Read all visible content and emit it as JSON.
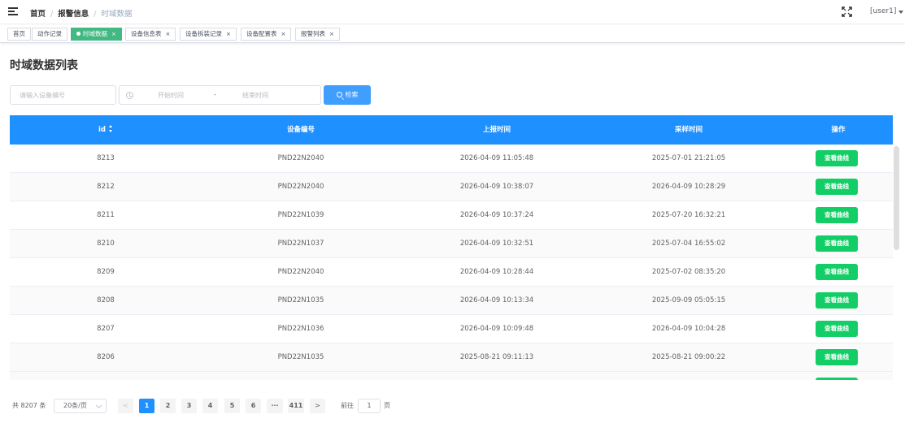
{
  "breadcrumb": [
    "首页",
    "报警信息",
    "时域数据"
  ],
  "user": {
    "name": "[user1]"
  },
  "tags": [
    {
      "label": "首页",
      "active": false,
      "closable": false
    },
    {
      "label": "动作记录",
      "active": false,
      "closable": false
    },
    {
      "label": "时域数据",
      "active": true,
      "closable": true
    },
    {
      "label": "设备信息表",
      "active": false,
      "closable": true
    },
    {
      "label": "设备拆装记录",
      "active": false,
      "closable": true
    },
    {
      "label": "设备配置表",
      "active": false,
      "closable": true
    },
    {
      "label": "报警列表",
      "active": false,
      "closable": true
    }
  ],
  "tag_close_glyph": "×",
  "page_title": "时域数据列表",
  "search": {
    "device_placeholder": "请输入设备编号",
    "start_placeholder": "开始时间",
    "range_separator": "-",
    "end_placeholder": "结束时间",
    "button_label": "检索"
  },
  "table": {
    "columns": [
      "id",
      "设备编号",
      "上报时间",
      "采样时间",
      "操作"
    ],
    "action_label": "查看曲线",
    "rows": [
      {
        "id": "8213",
        "device": "PND22N2040",
        "report_time": "2026-04-09 11:05:48",
        "sample_time": "2025-07-01 21:21:05"
      },
      {
        "id": "8212",
        "device": "PND22N2040",
        "report_time": "2026-04-09 10:38:07",
        "sample_time": "2026-04-09 10:28:29"
      },
      {
        "id": "8211",
        "device": "PND22N1039",
        "report_time": "2026-04-09 10:37:24",
        "sample_time": "2025-07-20 16:32:21"
      },
      {
        "id": "8210",
        "device": "PND22N1037",
        "report_time": "2026-04-09 10:32:51",
        "sample_time": "2025-07-04 16:55:02"
      },
      {
        "id": "8209",
        "device": "PND22N2040",
        "report_time": "2026-04-09 10:28:44",
        "sample_time": "2025-07-02 08:35:20"
      },
      {
        "id": "8208",
        "device": "PND22N1035",
        "report_time": "2026-04-09 10:13:34",
        "sample_time": "2025-09-09 05:05:15"
      },
      {
        "id": "8207",
        "device": "PND22N1036",
        "report_time": "2026-04-09 10:09:48",
        "sample_time": "2026-04-09 10:04:28"
      },
      {
        "id": "8206",
        "device": "PND22N1035",
        "report_time": "2025-08-21 09:11:13",
        "sample_time": "2025-08-21 09:00:22"
      }
    ]
  },
  "pagination": {
    "total_text": "共 8207 条",
    "page_size": "20条/页",
    "pages": [
      "1",
      "2",
      "3",
      "4",
      "5",
      "6",
      "···",
      "411"
    ],
    "current": "1",
    "prev_glyph": "<",
    "next_glyph": ">",
    "goto_label": "前往",
    "goto_value": "1",
    "goto_unit": "页"
  },
  "colors": {
    "header_blue": "#1e90ff",
    "active_tag": "#42b983",
    "action_green": "#13ce66",
    "primary": "#409eff"
  }
}
